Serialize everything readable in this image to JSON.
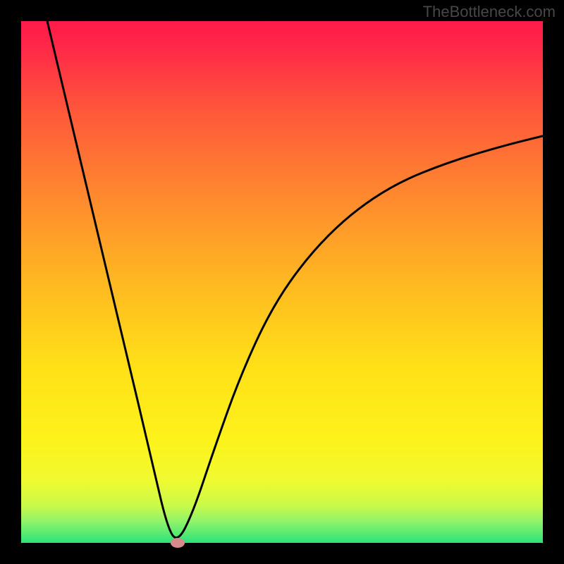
{
  "watermark": "TheBottleneck.com",
  "chart_data": {
    "type": "line",
    "title": "",
    "xlabel": "",
    "ylabel": "",
    "xlim": [
      0,
      100
    ],
    "ylim": [
      0,
      100
    ],
    "grid": false,
    "legend": false,
    "series": [
      {
        "name": "curve",
        "x": [
          5,
          10,
          15,
          20,
          25,
          28,
          30,
          33,
          37,
          42,
          48,
          55,
          63,
          72,
          82,
          92,
          100
        ],
        "y": [
          100,
          79,
          58,
          37,
          16,
          3,
          0,
          6,
          18,
          32,
          45,
          55,
          63,
          69,
          73,
          76,
          78
        ]
      }
    ],
    "marker": {
      "x": 30,
      "y": 0,
      "color": "#d98b8b"
    },
    "gradient_stops": [
      {
        "pos": 0,
        "color": "#ff1a4a"
      },
      {
        "pos": 50,
        "color": "#ffb821"
      },
      {
        "pos": 80,
        "color": "#fdf21a"
      },
      {
        "pos": 100,
        "color": "#2de27b"
      }
    ]
  }
}
